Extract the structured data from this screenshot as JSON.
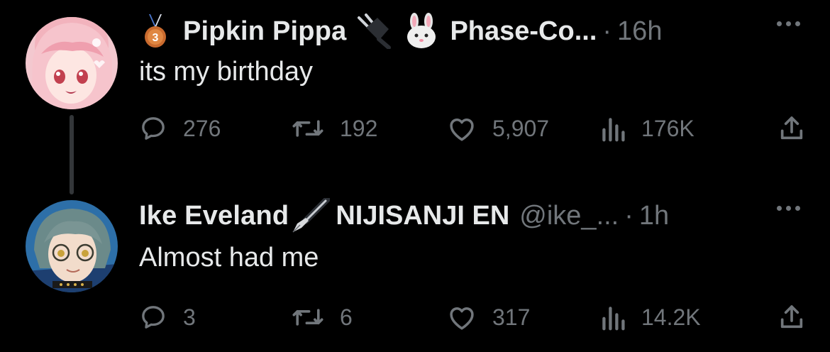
{
  "tweets": [
    {
      "display_name": "Pipkin Pippa",
      "badge": "third-place-medal-icon",
      "badge_text": "3",
      "emojis": [
        "plug-icon",
        "rabbit-face-icon"
      ],
      "affiliation": "Phase-Co...",
      "separator": "·",
      "time": "16h",
      "text": "its my birthday",
      "stats": {
        "replies": "276",
        "retweets": "192",
        "likes": "5,907",
        "views": "176K"
      }
    },
    {
      "display_name": "Ike Eveland",
      "emojis": [
        "fountain-pen-icon"
      ],
      "affiliation": "NIJISANJI EN",
      "handle": "@ike_...",
      "separator": "·",
      "time": "1h",
      "text": "Almost had me",
      "stats": {
        "replies": "3",
        "retweets": "6",
        "likes": "317",
        "views": "14.2K"
      }
    }
  ],
  "colors": {
    "background": "#000000",
    "primary_text": "#e7e9ea",
    "secondary_text": "#71767b",
    "thread_line": "#333639"
  }
}
